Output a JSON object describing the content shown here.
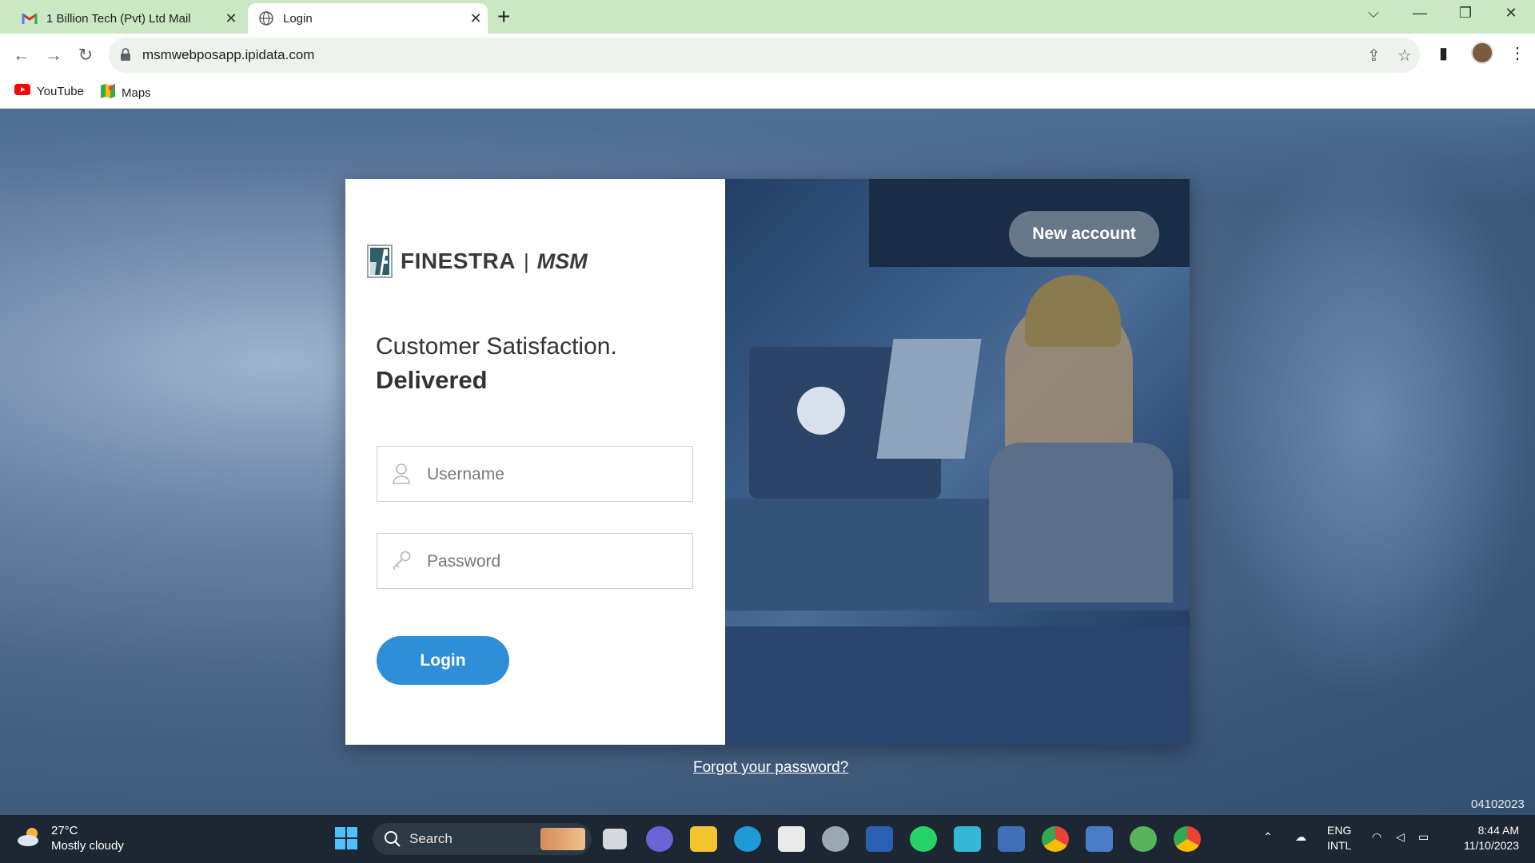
{
  "browser": {
    "tabs": [
      {
        "title": "1 Billion Tech (Pvt) Ltd Mail",
        "icon": "gmail-icon",
        "active": false
      },
      {
        "title": "Login",
        "icon": "globe-icon",
        "active": true
      }
    ],
    "url": "msmwebposapp.ipidata.com",
    "bookmarks": [
      {
        "label": "YouTube",
        "icon": "youtube-icon"
      },
      {
        "label": "Maps",
        "icon": "maps-icon"
      }
    ]
  },
  "login": {
    "brand": "FINESTRA",
    "separator": "|",
    "product": "MSM",
    "tagline_line1": "Customer Satisfaction.",
    "tagline_line2": "Delivered",
    "username_placeholder": "Username",
    "username_value": "",
    "password_placeholder": "Password",
    "password_value": "",
    "login_label": "Login",
    "new_account_label": "New account",
    "forgot_label": "Forgot your password?",
    "build_number": "04102023"
  },
  "taskbar": {
    "weather_temp": "27°C",
    "weather_desc": "Mostly cloudy",
    "search_label": "Search",
    "lang_line1": "ENG",
    "lang_line2": "INTL",
    "time": "8:44 AM",
    "date": "11/10/2023"
  },
  "colors": {
    "tabbar_bg": "#c9e8c3",
    "login_button": "#2e8fd8",
    "taskbar_bg": "#1d2733"
  }
}
